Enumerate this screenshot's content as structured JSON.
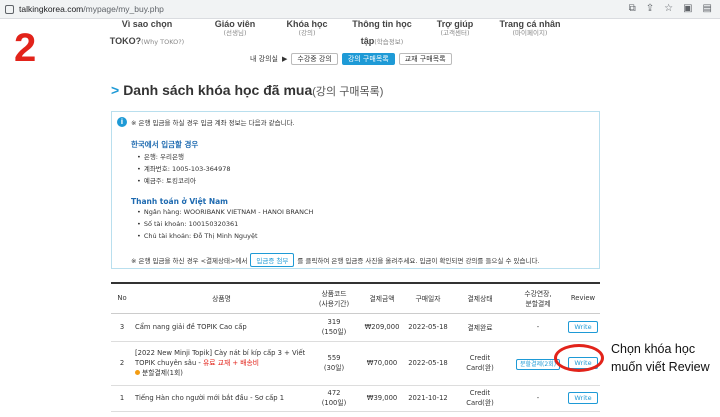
{
  "browser": {
    "url_host": "talkingkorea.com",
    "url_path": "/mypage/my_buy.php",
    "icons": [
      "translate-icon",
      "share-icon",
      "star-icon",
      "extensions-icon",
      "profile-icon"
    ]
  },
  "step_number": "2",
  "nav": [
    {
      "main": "Vì sao chọn",
      "main2": "TOKO?",
      "sub": "(Why TOKO?)"
    },
    {
      "main": "Giáo viên",
      "main2": "",
      "sub": "(선생님)"
    },
    {
      "main": "Khóa học",
      "main2": "",
      "sub": "(강의)"
    },
    {
      "main": "Thông tin học",
      "main2": "tập",
      "sub": "(학습정보)"
    },
    {
      "main": "Trợ giúp",
      "main2": "",
      "sub": "(고객센터)"
    },
    {
      "main": "Trang cá nhân",
      "main2": "",
      "sub": "(마이페이지)"
    }
  ],
  "subnav": {
    "label": "내 강의실",
    "tabs": [
      "수강중 강의",
      "강의 구매목록",
      "교재 구매목록"
    ]
  },
  "title": {
    "main": "Danh sách khóa học đã mua",
    "kr": "(강의 구매목록)"
  },
  "info": {
    "intro": "※ 은행 입금을 하실 경우 입금 계좌 정보는 다음과 같습니다.",
    "kr_title": "한국에서 입금할 경우",
    "kr_lines": [
      "은행: 우리은행",
      "계좌번호: 1005-103-364978",
      "예금주: 토킹코리아"
    ],
    "vn_title": "Thanh toán ở Việt Nam",
    "vn_lines": [
      "Ngân hàng: WOORIBANK VIETNAM - HANOI BRANCH",
      "Số tài khoản: 100150320361",
      "Chủ tài khoản: Đỗ Thị Minh Nguyệt"
    ],
    "foot_before": "※ 은행 입금을 하신 경우 <결제상태>에서",
    "foot_button": "입금증 첨부",
    "foot_after": "를 클릭하여 은행 입금증 사진을 올려주세요. 입금이 확인되면 강의를 들으실 수 있습니다."
  },
  "table": {
    "headers": [
      "No",
      "상품명",
      "상품코드",
      "결제금액",
      "구매일자",
      "결제상태",
      "수강연장,",
      "Review"
    ],
    "headers_extra": {
      "code_sub": "(사용기간)",
      "ext_sub": "분할결제"
    },
    "rows": [
      {
        "no": "3",
        "name": "Cẩm nang giải đề TOPIK Cao cấp",
        "name_red": "",
        "name_extra": "",
        "code": "319",
        "period": "(150일)",
        "amount": "₩209,000",
        "date": "2022-05-18",
        "status": "결제완료",
        "status2": "",
        "ext": "-",
        "review": "Write"
      },
      {
        "no": "2",
        "name": "[2022 New Minji Topik] Cày nát bí kíp cấp 3 + Viết TOPIK chuyên sâu - ",
        "name_red": "유료 교재 + 배송비",
        "name_extra": "분할결제(1회)",
        "code": "559",
        "period": "(30일)",
        "amount": "₩70,000",
        "date": "2022-05-18",
        "status": "Credit",
        "status2": "Card(완)",
        "ext": "분할결제(2회)",
        "review": "Write"
      },
      {
        "no": "1",
        "name": "Tiếng Hàn cho người mới bắt đầu - Sơ cấp 1",
        "name_red": "",
        "name_extra": "",
        "code": "472",
        "period": "(100일)",
        "amount": "₩39,000",
        "date": "2021-10-12",
        "status": "Credit",
        "status2": "Card(완)",
        "ext": "-",
        "review": "Write"
      }
    ]
  },
  "annotation": {
    "line1": "Chọn khóa học",
    "line2": "muốn viết Review"
  },
  "colors": {
    "accent": "#1e9ad6",
    "highlight": "#e2231a"
  }
}
